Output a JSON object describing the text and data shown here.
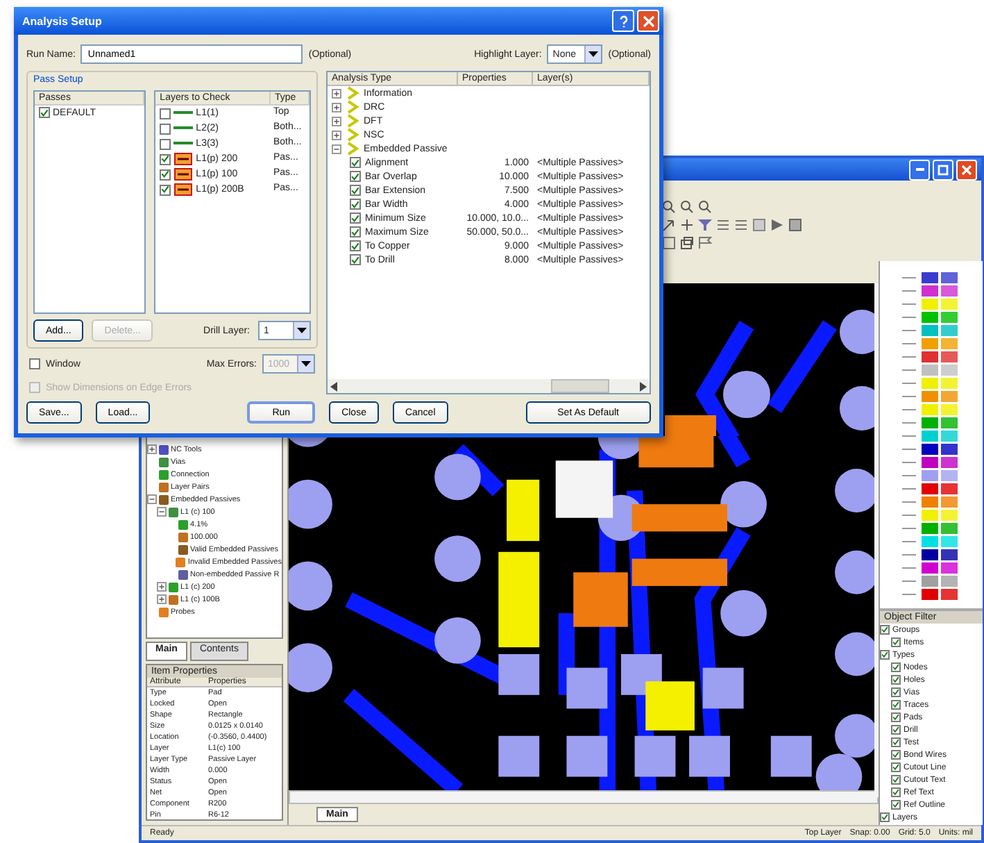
{
  "main_window": {
    "tree": [
      {
        "label": "NC Tools",
        "expanded": false
      },
      {
        "label": "Vias"
      },
      {
        "label": "Connection"
      },
      {
        "label": "Layer Pairs"
      },
      {
        "label": "Embedded Passives",
        "expanded": true,
        "children": [
          {
            "label": "L1 (c) 100",
            "expanded": true,
            "children": [
              {
                "label": "4.1%"
              },
              {
                "label": "100.000"
              },
              {
                "label": "Valid Embedded Passives"
              },
              {
                "label": "Invalid Embedded Passives"
              },
              {
                "label": "Non-embedded Passive R"
              }
            ]
          },
          {
            "label": "L1 (c) 200",
            "expanded": false
          },
          {
            "label": "L1 (c) 100B",
            "expanded": false
          }
        ]
      },
      {
        "label": "Probes"
      }
    ],
    "panel_tabs": [
      {
        "label": "Main",
        "selected": true
      },
      {
        "label": "Contents",
        "selected": false
      }
    ],
    "properties": {
      "title": "Item Properties",
      "columns": [
        "Attribute",
        "Properties"
      ],
      "rows": [
        [
          "Type",
          "Pad"
        ],
        [
          "Locked",
          "Open"
        ],
        [
          "Shape",
          "Rectangle"
        ],
        [
          "Size",
          "0.0125 x 0.0140"
        ],
        [
          "Location",
          "(-0.3560, 0.4400)"
        ],
        [
          "Layer",
          "L1(c) 100"
        ],
        [
          "Layer Type",
          "Passive Layer"
        ],
        [
          "Width",
          "0.000"
        ],
        [
          "Status",
          "Open"
        ],
        [
          "Net",
          "Open"
        ],
        [
          "Component",
          "R200"
        ],
        [
          "Pin",
          "R6-12"
        ]
      ]
    },
    "filters": {
      "title": "Object Filter",
      "items": [
        {
          "label": "Groups",
          "checked": true,
          "children": [
            {
              "label": "Items",
              "checked": true
            }
          ]
        },
        {
          "label": "Types",
          "checked": true,
          "children": [
            {
              "label": "Nodes",
              "checked": true
            },
            {
              "label": "Holes",
              "checked": true
            },
            {
              "label": "Vias",
              "checked": true
            },
            {
              "label": "Traces",
              "checked": true
            },
            {
              "label": "Pads",
              "checked": true
            },
            {
              "label": "Drill",
              "checked": true
            },
            {
              "label": "Test",
              "checked": true
            },
            {
              "label": "Bond Wires",
              "checked": true
            },
            {
              "label": "Cutout Line",
              "checked": true
            },
            {
              "label": "Cutout Text",
              "checked": true
            },
            {
              "label": "Ref Text",
              "checked": true
            },
            {
              "label": "Ref Outline",
              "checked": true
            }
          ]
        },
        {
          "label": "Layers",
          "checked": true
        }
      ]
    },
    "canvas_tabs": [
      {
        "label": "Main",
        "selected": true
      }
    ],
    "status_bar": [
      "Ready",
      "Top Layer",
      "Snap: 0.00",
      "Grid: 5.0",
      "Units: mil"
    ]
  },
  "dialog": {
    "title": "Analysis Setup",
    "run_name": {
      "label": "Run Name:",
      "value": "Unnamed1",
      "note": "(Optional)"
    },
    "highlight_layer": {
      "label": "Highlight Layer:",
      "value": "None",
      "note": "(Optional)"
    },
    "pass_setup": {
      "title": "Pass Setup",
      "passes": {
        "column": "Passes",
        "items": [
          {
            "label": "DEFAULT",
            "checked": true
          }
        ]
      },
      "layers": {
        "columns": [
          "Layers to Check",
          "Type"
        ],
        "rows": [
          {
            "name": "L1(1)",
            "type": "Top",
            "checked": false,
            "kind": "line"
          },
          {
            "name": "L2(2)",
            "type": "Both...",
            "checked": false,
            "kind": "line"
          },
          {
            "name": "L3(3)",
            "type": "Both...",
            "checked": false,
            "kind": "line"
          },
          {
            "name": "L1(p) 200",
            "type": "Pas...",
            "checked": true,
            "kind": "passive"
          },
          {
            "name": "L1(p) 100",
            "type": "Pas...",
            "checked": true,
            "kind": "passive"
          },
          {
            "name": "L1(p) 200B",
            "type": "Pas...",
            "checked": true,
            "kind": "passive"
          }
        ]
      },
      "buttons": [
        {
          "label": "Add...",
          "disabled": false
        },
        {
          "label": "Delete...",
          "disabled": true
        }
      ],
      "drill": {
        "label": "Drill Layer:",
        "value": "1"
      }
    },
    "options": [
      {
        "label": "Window",
        "checked": false,
        "disabled": false
      },
      {
        "label": "Show Dimensions on Edge Errors",
        "checked": false,
        "disabled": true
      }
    ],
    "max_errors": {
      "label": "Max Errors:",
      "value": "1000",
      "disabled": true
    },
    "analysis": {
      "columns": [
        "Analysis Type",
        "Properties",
        "Layer(s)"
      ],
      "rows": [
        {
          "label": "Information",
          "expanded": false
        },
        {
          "label": "DRC",
          "expanded": false
        },
        {
          "label": "DFT",
          "expanded": false
        },
        {
          "label": "NSC",
          "expanded": false
        },
        {
          "label": "Embedded Passive",
          "expanded": true,
          "children": [
            {
              "label": "Alignment",
              "checked": true,
              "value": "1.000",
              "layers": "<Multiple Passives>"
            },
            {
              "label": "Bar Overlap",
              "checked": true,
              "value": "10.000",
              "layers": "<Multiple Passives>"
            },
            {
              "label": "Bar Extension",
              "checked": true,
              "value": "7.500",
              "layers": "<Multiple Passives>"
            },
            {
              "label": "Bar Width",
              "checked": true,
              "value": "4.000",
              "layers": "<Multiple Passives>"
            },
            {
              "label": "Minimum Size",
              "checked": true,
              "value": "10.000, 10.0...",
              "layers": "<Multiple Passives>"
            },
            {
              "label": "Maximum Size",
              "checked": true,
              "value": "50.000, 50.0...",
              "layers": "<Multiple Passives>"
            },
            {
              "label": "To Copper",
              "checked": true,
              "value": "9.000",
              "layers": "<Multiple Passives>"
            },
            {
              "label": "To Drill",
              "checked": true,
              "value": "8.000",
              "layers": "<Multiple Passives>"
            }
          ]
        }
      ]
    },
    "buttons": [
      {
        "label": "Save...",
        "kind": "left"
      },
      {
        "label": "Load...",
        "kind": "left"
      },
      {
        "label": "Run",
        "kind": "default"
      },
      {
        "label": "Close",
        "kind": "normal"
      },
      {
        "label": "Cancel",
        "kind": "normal"
      },
      {
        "label": "Set As Default",
        "kind": "wide"
      }
    ]
  }
}
